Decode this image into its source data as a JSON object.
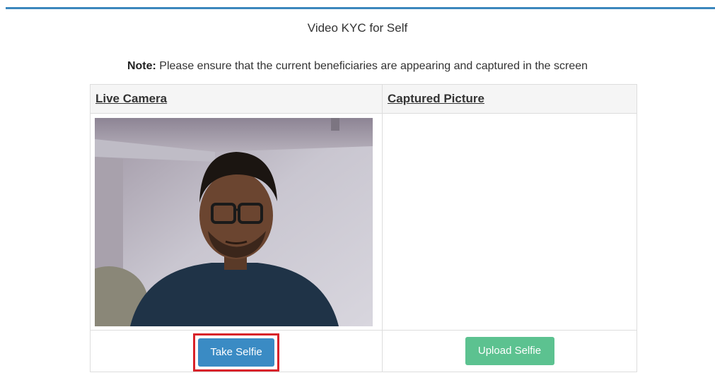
{
  "page": {
    "title": "Video KYC for Self",
    "note_label": "Note:",
    "note_text": " Please ensure that the current beneficiaries are appearing and captured in the screen"
  },
  "table": {
    "headers": {
      "live_camera": "Live Camera",
      "captured_picture": "Captured Picture"
    },
    "buttons": {
      "take_selfie": "Take Selfie",
      "upload_selfie": "Upload Selfie"
    }
  },
  "colors": {
    "accent_rule": "#3b87bd",
    "take_selfie_button": "#3a8bc4",
    "upload_selfie_button": "#5cc290",
    "highlight_outline": "#d8232a"
  }
}
